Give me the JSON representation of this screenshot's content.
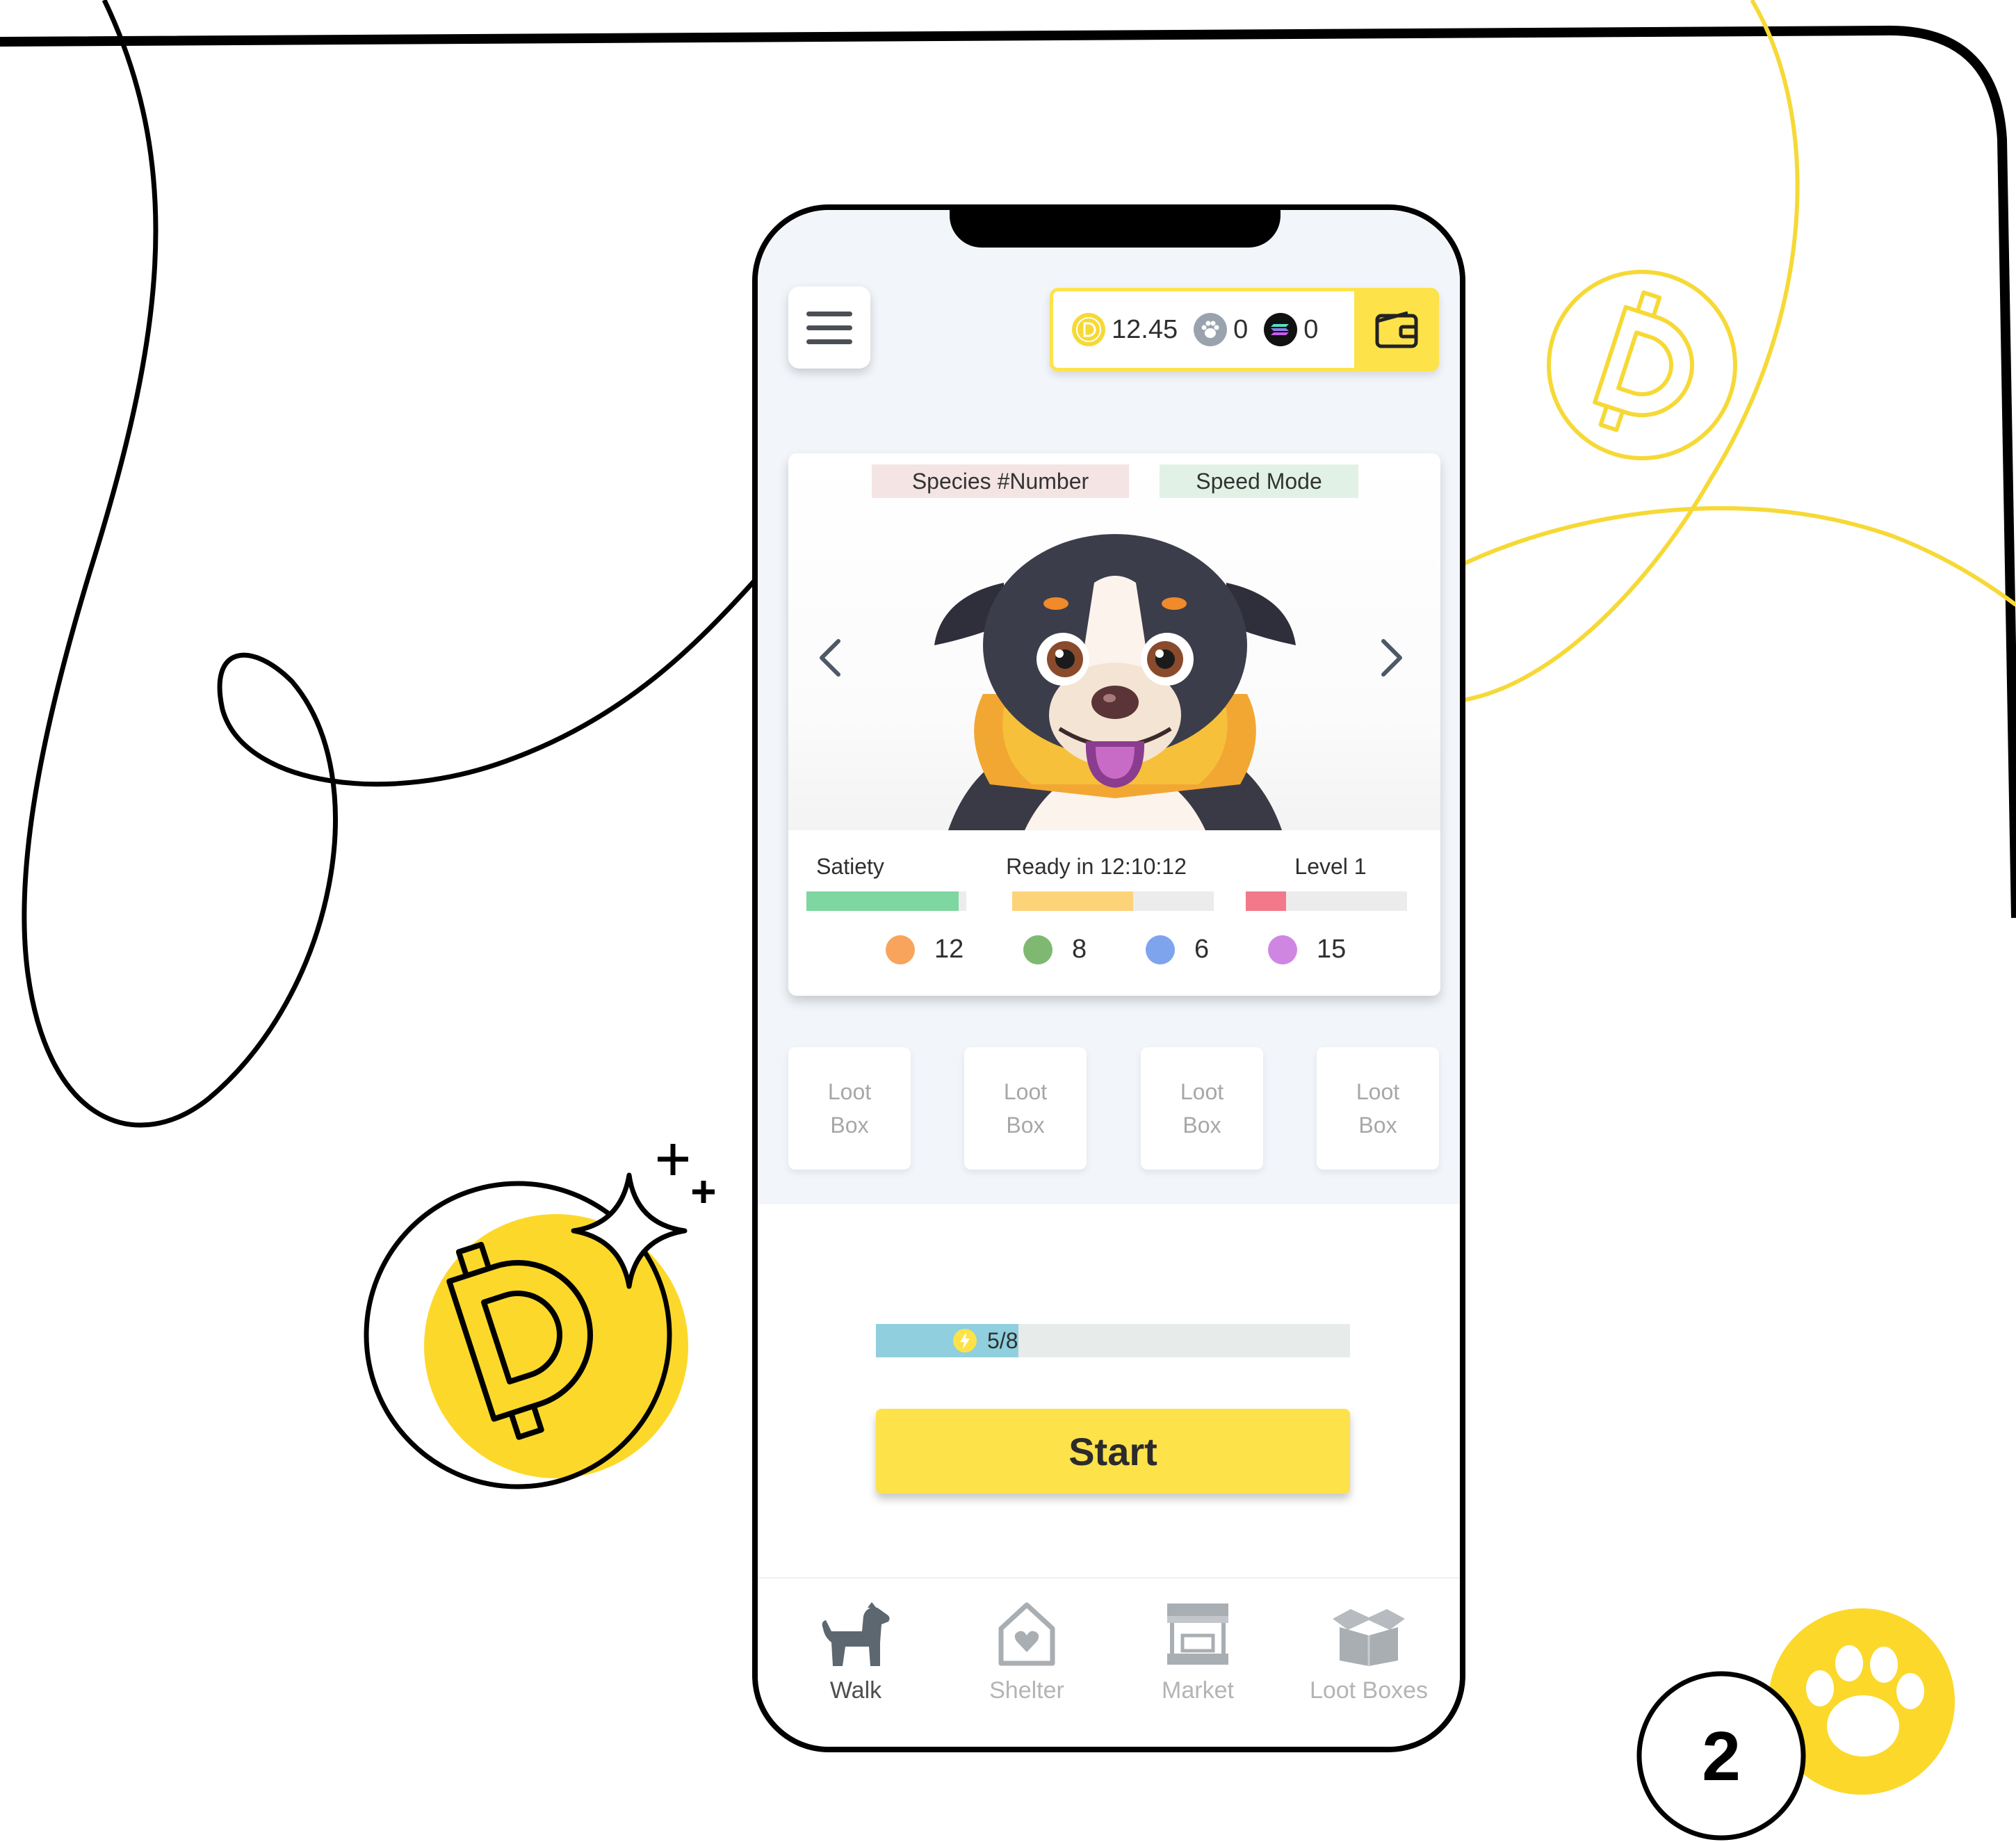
{
  "colors": {
    "accent": "#fde24a",
    "coin_yellow": "#f6d936",
    "satiety": "#7ed6a0",
    "ready": "#fdd37a",
    "level": "#f2798a",
    "energy": "#8fcfde"
  },
  "header": {
    "menu_icon": "hamburger-icon",
    "balances": [
      {
        "icon": "dogecoin-icon",
        "value": "12.45"
      },
      {
        "icon": "paw-coin-icon",
        "value": "0"
      },
      {
        "icon": "solana-icon",
        "value": "0"
      }
    ],
    "wallet_icon": "wallet-icon"
  },
  "pet": {
    "species_tag": "Species #Number",
    "mode_tag": "Speed Mode",
    "stats": {
      "satiety_label": "Satiety",
      "satiety_fraction": 0.95,
      "ready_label": "Ready in 12:10:12",
      "ready_fraction": 0.6,
      "level_label": "Level 1",
      "level_fraction": 0.25
    },
    "attributes": [
      {
        "color": "#f9a45c",
        "value": "12"
      },
      {
        "color": "#7fb870",
        "value": "8"
      },
      {
        "color": "#7ea4ee",
        "value": "6"
      },
      {
        "color": "#cf86e2",
        "value": "15"
      }
    ]
  },
  "loot_boxes": [
    "Loot Box",
    "Loot Box",
    "Loot Box",
    "Loot Box"
  ],
  "energy": {
    "text": "5/8",
    "fraction": 0.3
  },
  "start_label": "Start",
  "nav": [
    {
      "label": "Walk",
      "icon": "dog-icon"
    },
    {
      "label": "Shelter",
      "icon": "shelter-icon"
    },
    {
      "label": "Market",
      "icon": "market-icon"
    },
    {
      "label": "Loot Boxes",
      "icon": "loot-box-icon"
    }
  ],
  "badge_number": "2"
}
